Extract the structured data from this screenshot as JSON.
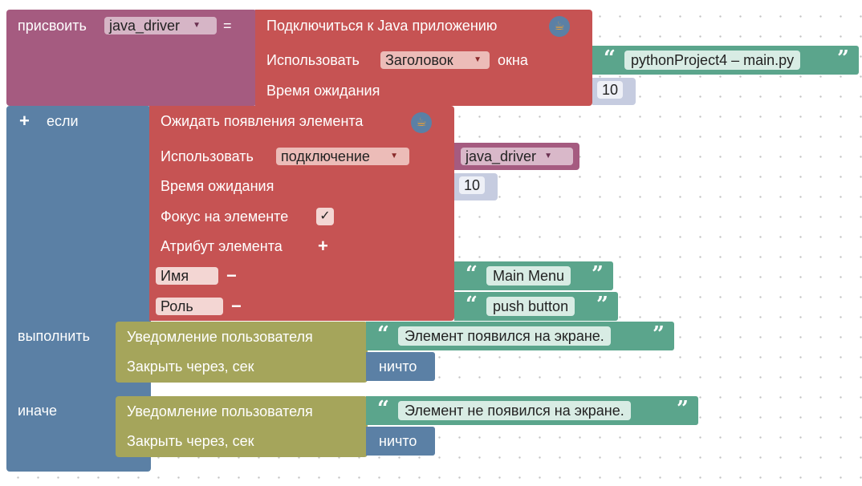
{
  "assign": {
    "label": "присвоить",
    "variable": "java_driver",
    "equals": "="
  },
  "connect": {
    "title": "Подключиться к Java приложению",
    "use_label": "Использовать",
    "use_value": "Заголовок",
    "window_label": "окна",
    "window_value": "pythonProject4 – main.py",
    "timeout_label": "Время ожидания",
    "timeout_value": "10"
  },
  "if_block": {
    "plus": "+",
    "if_label": "если",
    "do_label": "выполнить",
    "else_label": "иначе"
  },
  "wait": {
    "title": "Ожидать появления элемента",
    "use_label": "Использовать",
    "use_value": "подключение",
    "driver_value": "java_driver",
    "timeout_label": "Время ожидания",
    "timeout_value": "10",
    "focus_label": "Фокус на элементе",
    "focus_checked": "✓",
    "attr_label": "Атрибут элемента",
    "attr_plus": "+",
    "attrs": [
      {
        "name": "Имя",
        "minus": "−",
        "value": "Main Menu"
      },
      {
        "name": "Роль",
        "minus": "−",
        "value": "push button"
      }
    ]
  },
  "notify_do": {
    "label": "Уведомление пользователя",
    "message": "Элемент появился на экране.",
    "close_label": "Закрыть через, сек",
    "close_value": "ничто"
  },
  "notify_else": {
    "label": "Уведомление пользователя",
    "message": "Элемент не появился на экране.",
    "close_label": "Закрыть через, сек",
    "close_value": "ничто"
  },
  "colors": {
    "variables": "#a55b80",
    "java": "#c65353",
    "logic": "#5b80a5",
    "notify": "#a5a55b",
    "text": "#5ba58c",
    "math": "#c6cce0"
  }
}
